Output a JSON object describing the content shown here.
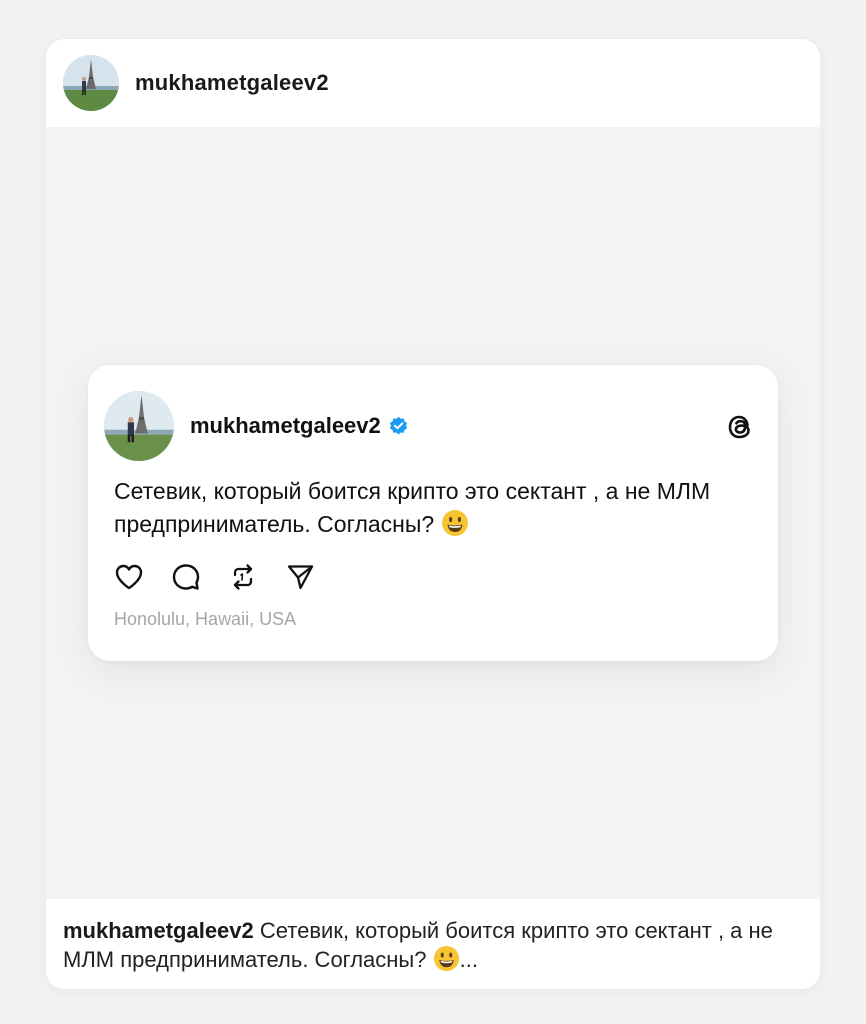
{
  "post": {
    "username": "mukhametgaleev2"
  },
  "thread": {
    "username": "mukhametgaleev2",
    "text": "Сетевик, который боится крипто это сектант , а не МЛМ предприниматель. Согласны?",
    "emoji": "😃",
    "location": "Honolulu, Hawaii, USA",
    "icons": [
      "heart-icon",
      "comment-icon",
      "repost-icon",
      "share-icon",
      "threads-logo-icon",
      "verified-badge-icon"
    ]
  },
  "caption": {
    "username": "mukhametgaleev2",
    "text": "Сетевик, который боится крипто это сектант , а не МЛМ предприниматель. Согласны?",
    "emoji": "😃",
    "more": "..."
  },
  "colors": {
    "background": "#f2f2f2",
    "card": "#ffffff",
    "verified": "#1d9bf0",
    "muted_text": "#a6a6a6",
    "emoji_yellow": "#f7c531"
  }
}
